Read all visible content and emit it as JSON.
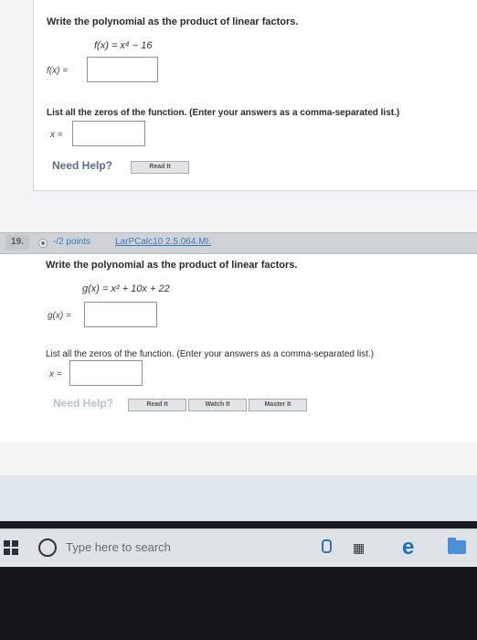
{
  "problem_prev": {
    "instruction": "Write the polynomial as the product of linear factors.",
    "function": "f(x) = x⁴ − 16",
    "answer_label": "f(x) =",
    "zeros_instruction": "List all the zeros of the function. (Enter your answers as a comma-separated list.)",
    "x_label": "x =",
    "need_help": "Need Help?",
    "read_it": "Read It"
  },
  "problem_19": {
    "number": "19.",
    "points": "-/2 points",
    "source": "LarPCalc10 2.5.064.MI.",
    "instruction": "Write the polynomial as the product of linear factors.",
    "function": "g(x) = x² + 10x + 22",
    "answer_label": "g(x) =",
    "zeros_instruction": "List all the zeros of the function. (Enter your answers as a comma-separated list.)",
    "x_label": "x =",
    "need_help": "Need Help?",
    "read_it": "Read It",
    "watch_it": "Watch It",
    "master_it": "Master It"
  },
  "taskbar": {
    "search_placeholder": "Type here to search"
  },
  "icons": [
    "windows-start-icon",
    "search-circle-icon",
    "microphone-icon",
    "task-view-icon",
    "edge-browser-icon",
    "file-explorer-icon"
  ],
  "colors": {
    "link_blue": "#3a78b8",
    "header_gray": "#cfd3d8",
    "need_help_text": "#5a6f8a"
  }
}
